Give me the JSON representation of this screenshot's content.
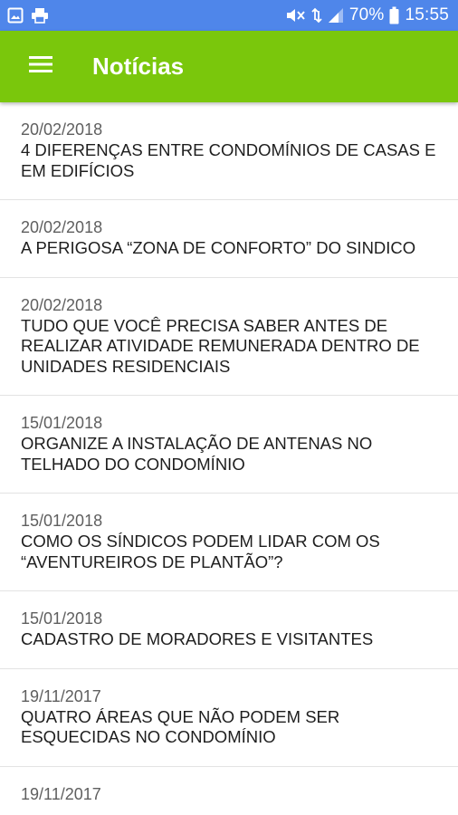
{
  "status_bar": {
    "battery": "70%",
    "time": "15:55",
    "icons": [
      "gallery-notification-icon",
      "printer-notification-icon",
      "mute-icon",
      "data-transfer-icon",
      "signal-icon",
      "battery-icon"
    ]
  },
  "app_bar": {
    "title": "Notícias",
    "menu_icon": "hamburger-menu-icon",
    "color": "#7ac70c"
  },
  "news": [
    {
      "date": "20/02/2018",
      "title": "4 DIFERENÇAS ENTRE CONDOMÍNIOS DE CASAS E EM EDIFÍCIOS"
    },
    {
      "date": "20/02/2018",
      "title": "A PERIGOSA “ZONA DE CONFORTO” DO SINDICO"
    },
    {
      "date": "20/02/2018",
      "title": "TUDO QUE VOCÊ PRECISA SABER ANTES DE REALIZAR ATIVIDADE REMUNERADA DENTRO DE UNIDADES RESIDENCIAIS"
    },
    {
      "date": "15/01/2018",
      "title": "ORGANIZE A INSTALAÇÃO DE ANTENAS NO TELHADO DO CONDOMÍNIO"
    },
    {
      "date": "15/01/2018",
      "title": "COMO OS SÍNDICOS PODEM LIDAR COM OS “AVENTUREIROS DE PLANTÃO”?"
    },
    {
      "date": "15/01/2018",
      "title": "CADASTRO DE MORADORES E VISITANTES"
    },
    {
      "date": "19/11/2017",
      "title": "QUATRO ÁREAS QUE NÃO PODEM SER ESQUECIDAS NO CONDOMÍNIO"
    },
    {
      "date": "19/11/2017",
      "title": ""
    }
  ]
}
